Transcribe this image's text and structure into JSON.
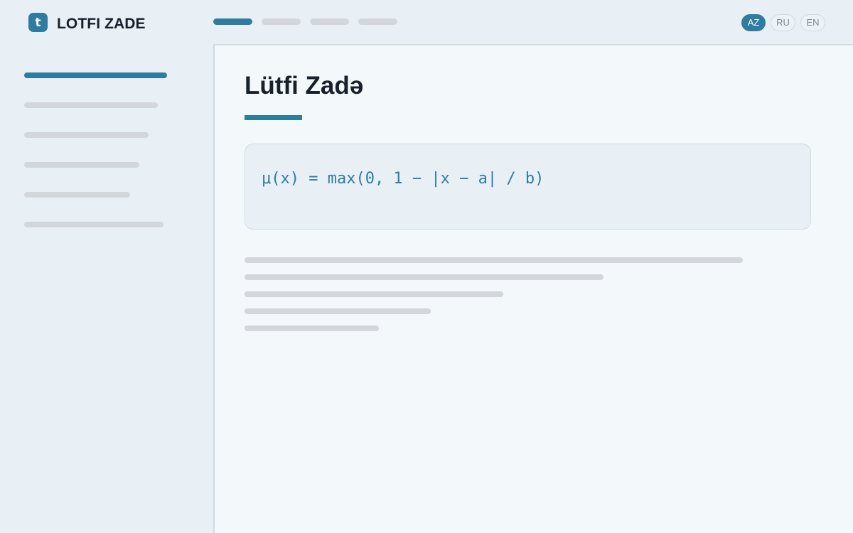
{
  "header": {
    "logo_letter": "t",
    "logo_text": "LOTFI ZADE",
    "nav_items": [
      {
        "active": true
      },
      {
        "active": false
      },
      {
        "active": false
      },
      {
        "active": false
      }
    ],
    "languages": [
      {
        "label": "AZ",
        "active": true
      },
      {
        "label": "RU",
        "active": false
      },
      {
        "label": "EN",
        "active": false
      }
    ]
  },
  "sidebar": {
    "items": [
      {
        "active": true
      },
      {
        "active": false
      },
      {
        "active": false
      },
      {
        "active": false
      },
      {
        "active": false
      },
      {
        "active": false
      }
    ]
  },
  "main": {
    "title": "Lütfi Zadə",
    "formula": "μ(x) = max(0, 1 − |x − a| / b)"
  },
  "colors": {
    "accent": "#2e7da0",
    "background": "#e8eff5",
    "panel": "#f3f8fb",
    "placeholder": "#d3d7db",
    "text": "#17212c"
  }
}
